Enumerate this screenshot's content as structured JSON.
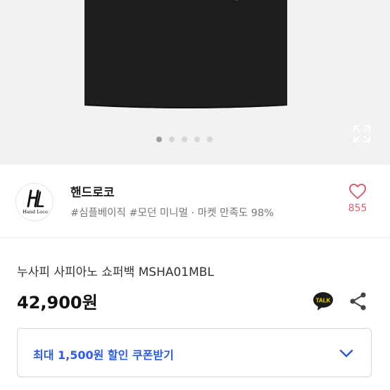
{
  "carousel": {
    "total_slides": 5,
    "active_slide": 1,
    "expand_icon": "expand-icon"
  },
  "seller": {
    "logo_text": "Hand Loco",
    "logo_monogram": "HL",
    "name": "핸드로코",
    "tags": "#심플베이직 #모던 미니멀 · 마켓 만족도 98%",
    "like_count": "855",
    "like_icon": "heart-outline-icon",
    "like_color": "#e05b6f"
  },
  "product": {
    "name": "누사피 사피아노 쇼퍼백 MSHA01MBL",
    "price": "42,900원",
    "talk_label": "TALK"
  },
  "coupon": {
    "label": "최대 1,500원 할인 쿠폰받기",
    "accent": "#2b5dde",
    "chevron_icon": "chevron-down-icon"
  }
}
